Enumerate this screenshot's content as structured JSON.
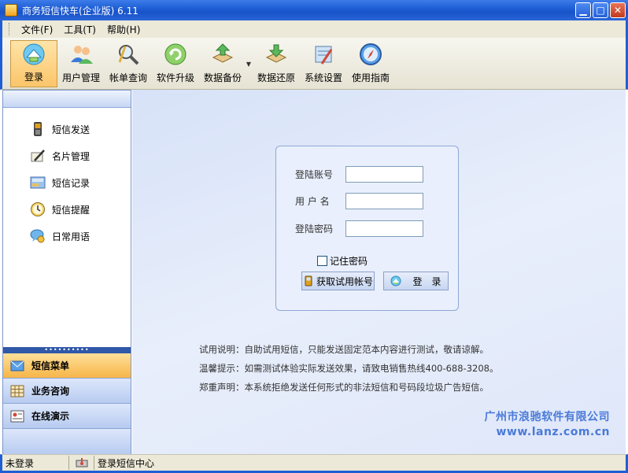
{
  "window": {
    "title": "商务短信快车(企业版) 6.11"
  },
  "menu": [
    "文件(F)",
    "工具(T)",
    "帮助(H)"
  ],
  "toolbar": [
    {
      "label": "登录",
      "icon": "login-icon",
      "active": true
    },
    {
      "label": "用户管理",
      "icon": "users-icon"
    },
    {
      "label": "帐单查询",
      "icon": "bill-query-icon"
    },
    {
      "label": "软件升级",
      "icon": "upgrade-icon"
    },
    {
      "label": "数据备份",
      "icon": "backup-icon",
      "dropdown": true
    },
    {
      "label": "数据还原",
      "icon": "restore-icon"
    },
    {
      "label": "系统设置",
      "icon": "settings-icon"
    },
    {
      "label": "使用指南",
      "icon": "guide-icon"
    }
  ],
  "sidebar": {
    "items": [
      {
        "label": "短信发送",
        "icon": "mobile-phone-icon"
      },
      {
        "label": "名片管理",
        "icon": "pen-card-icon"
      },
      {
        "label": "短信记录",
        "icon": "records-icon"
      },
      {
        "label": "短信提醒",
        "icon": "clock-icon"
      },
      {
        "label": "日常用语",
        "icon": "chat-bubble-icon"
      }
    ],
    "categories": [
      {
        "label": "短信菜单",
        "icon": "sms-menu-icon",
        "active": true
      },
      {
        "label": "业务咨询",
        "icon": "grid-icon"
      },
      {
        "label": "在线演示",
        "icon": "demo-icon"
      }
    ]
  },
  "login": {
    "account_label": "登陆账号",
    "username_label": "用 户 名",
    "password_label": "登陆密码",
    "account_value": "",
    "username_value": "",
    "password_value": "",
    "remember_label": "记住密码",
    "trial_button": "获取试用帐号",
    "login_button": "登　录"
  },
  "notes": [
    "试用说明：自助试用短信，只能发送固定范本内容进行测试，敬请谅解。",
    "温馨提示：如需测试体验实际发送效果，请致电销售热线400-688-3208。",
    "郑重声明：本系统拒绝发送任何形式的非法短信和号码段垃圾广告短信。"
  ],
  "company": {
    "name": "广州市浪驰软件有限公司",
    "url": "www.lanz.com.cn"
  },
  "status": {
    "login_state": "未登录",
    "center": "登录短信中心"
  }
}
